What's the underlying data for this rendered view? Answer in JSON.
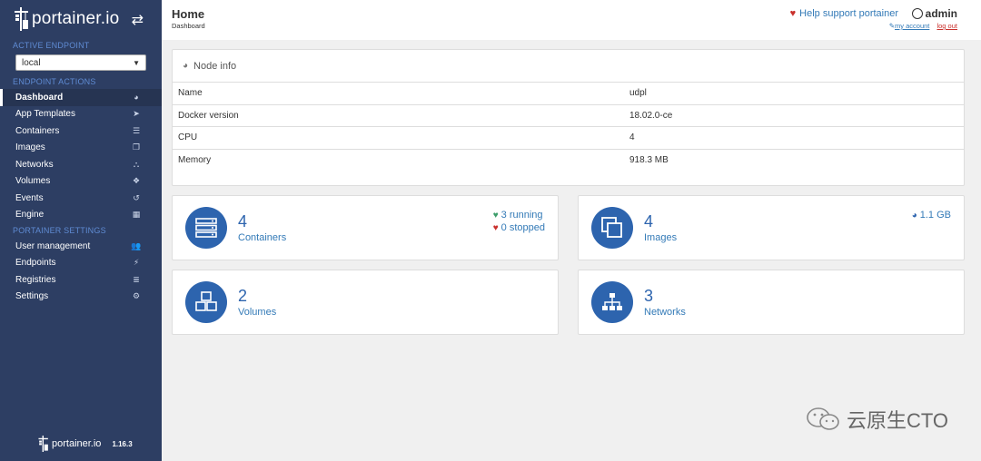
{
  "sidebar": {
    "brand": "portainer.io",
    "active_endpoint_title": "ACTIVE ENDPOINT",
    "endpoint_value": "local",
    "endpoint_actions_title": "ENDPOINT ACTIONS",
    "actions": [
      {
        "label": "Dashboard",
        "icon": "dashboard-icon",
        "glyph": "◕"
      },
      {
        "label": "App Templates",
        "icon": "rocket-icon",
        "glyph": "➤"
      },
      {
        "label": "Containers",
        "icon": "list-icon",
        "glyph": "☰"
      },
      {
        "label": "Images",
        "icon": "clone-icon",
        "glyph": "❐"
      },
      {
        "label": "Networks",
        "icon": "sitemap-icon",
        "glyph": "⛬"
      },
      {
        "label": "Volumes",
        "icon": "cubes-icon",
        "glyph": "❖"
      },
      {
        "label": "Events",
        "icon": "history-icon",
        "glyph": "↺"
      },
      {
        "label": "Engine",
        "icon": "th-icon",
        "glyph": "▦"
      }
    ],
    "settings_title": "PORTAINER SETTINGS",
    "settings": [
      {
        "label": "User management",
        "icon": "users-icon",
        "glyph": "👥"
      },
      {
        "label": "Endpoints",
        "icon": "plug-icon",
        "glyph": "⚡"
      },
      {
        "label": "Registries",
        "icon": "database-icon",
        "glyph": "≣"
      },
      {
        "label": "Settings",
        "icon": "cogs-icon",
        "glyph": "⚙"
      }
    ],
    "footer_brand": "portainer.io",
    "footer_version": "1.16.3"
  },
  "header": {
    "title": "Home",
    "breadcrumb": "Dashboard",
    "help": "Help support portainer",
    "user": "admin",
    "my_account": "my account",
    "log_out": "log out"
  },
  "node_info": {
    "title": "Node info",
    "rows": [
      {
        "key": "Name",
        "value": "udpl"
      },
      {
        "key": "Docker version",
        "value": "18.02.0-ce"
      },
      {
        "key": "CPU",
        "value": "4"
      },
      {
        "key": "Memory",
        "value": "918.3 MB"
      }
    ]
  },
  "stats": {
    "containers": {
      "count": "4",
      "label": "Containers",
      "running": "3 running",
      "stopped": "0 stopped"
    },
    "images": {
      "count": "4",
      "label": "Images",
      "size": "1.1 GB"
    },
    "volumes": {
      "count": "2",
      "label": "Volumes"
    },
    "networks": {
      "count": "3",
      "label": "Networks"
    }
  },
  "watermark": "云原生CTO",
  "colors": {
    "sidebar": "#2d3e63",
    "accent": "#2d64ae",
    "link": "#337ab7",
    "danger": "#c9302c",
    "success": "#3c9d6a"
  }
}
